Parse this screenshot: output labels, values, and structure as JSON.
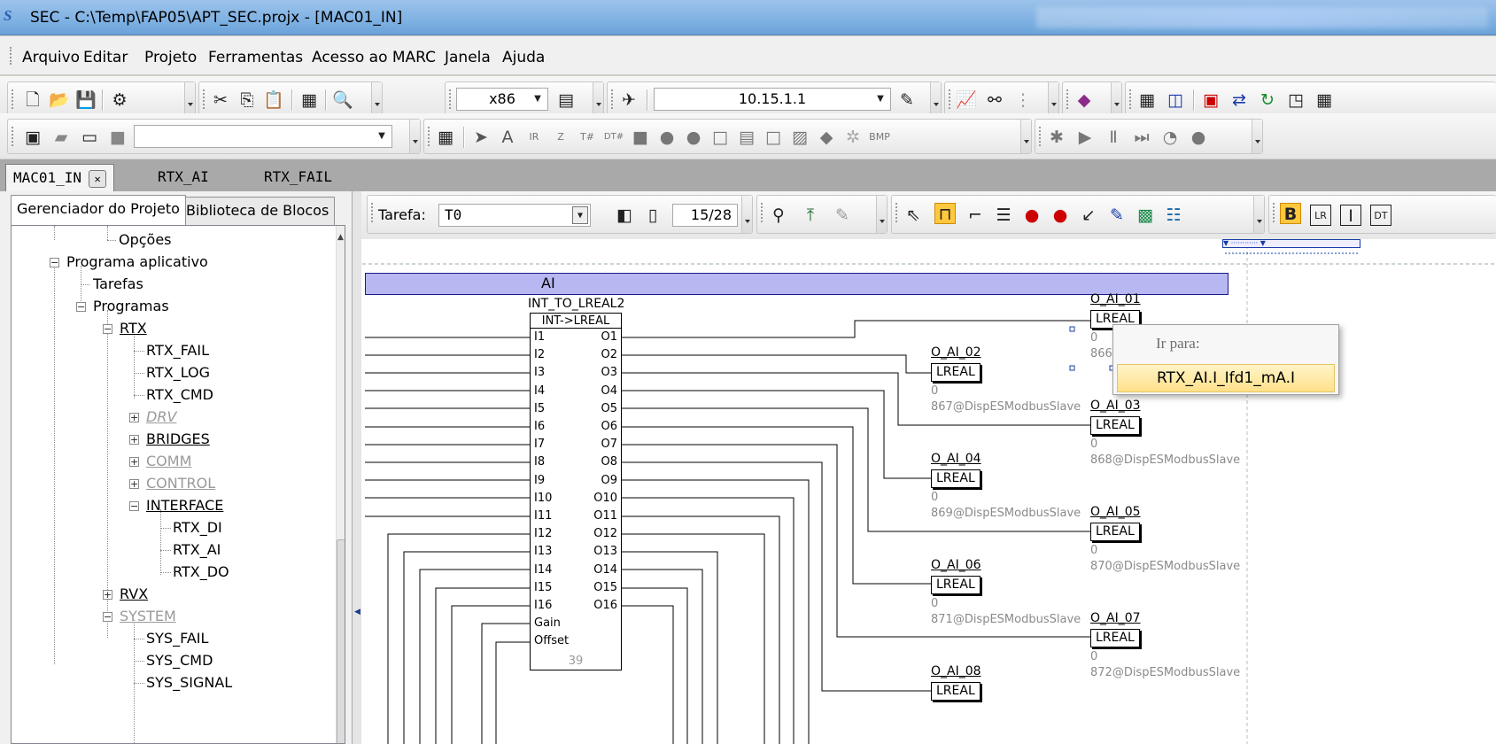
{
  "window": {
    "title": "SEC - C:\\Temp\\FAP05\\APT_SEC.projx - [MAC01_IN]",
    "logo": "S"
  },
  "menu": [
    "Arquivo",
    "Editar",
    "Projeto",
    "Ferramentas",
    "Acesso ao MARC",
    "Janela",
    "Ajuda"
  ],
  "toolbar": {
    "platform": "x86",
    "ip": "10.15.1.1"
  },
  "doc_tabs": [
    "MAC01_IN",
    "RTX_AI",
    "RTX_FAIL"
  ],
  "panel_tabs": [
    "Gerenciador do Projeto",
    "Biblioteca de Blocos"
  ],
  "tree": [
    {
      "label": "Opções"
    },
    {
      "label": "Programa aplicativo"
    },
    {
      "label": "Tarefas"
    },
    {
      "label": "Programas"
    },
    {
      "label": "RTX"
    },
    {
      "label": "RTX_FAIL"
    },
    {
      "label": "RTX_LOG"
    },
    {
      "label": "RTX_CMD"
    },
    {
      "label": "DRV"
    },
    {
      "label": "BRIDGES"
    },
    {
      "label": "COMM"
    },
    {
      "label": "CONTROL"
    },
    {
      "label": "INTERFACE"
    },
    {
      "label": "RTX_DI"
    },
    {
      "label": "RTX_AI"
    },
    {
      "label": "RTX_DO"
    },
    {
      "label": "RVX"
    },
    {
      "label": "SYSTEM"
    },
    {
      "label": "SYS_FAIL"
    },
    {
      "label": "SYS_CMD"
    },
    {
      "label": "SYS_SIGNAL"
    }
  ],
  "diagram": {
    "task_label": "Tarefa:",
    "task_value": "T0",
    "page": "15/28",
    "section": "AI",
    "block": {
      "name": "INT_TO_LREAL2",
      "type": "INT->LREAL",
      "inputs": [
        "I1",
        "I2",
        "I3",
        "I4",
        "I5",
        "I6",
        "I7",
        "I8",
        "I9",
        "I10",
        "I11",
        "I12",
        "I13",
        "I14",
        "I15",
        "I16",
        "Gain",
        "Offset"
      ],
      "outputs": [
        "O1",
        "O2",
        "O3",
        "O4",
        "O5",
        "O6",
        "O7",
        "O8",
        "O9",
        "O10",
        "O11",
        "O12",
        "O13",
        "O14",
        "O15",
        "O16"
      ],
      "id": "39"
    },
    "type_label": "LREAL",
    "value": "0",
    "vars": [
      {
        "name": "O_AI_01",
        "addr": "866@"
      },
      {
        "name": "O_AI_02",
        "addr": "867@DispESModbusSlave"
      },
      {
        "name": "O_AI_03",
        "addr": "868@DispESModbusSlave"
      },
      {
        "name": "O_AI_04",
        "addr": "869@DispESModbusSlave"
      },
      {
        "name": "O_AI_05",
        "addr": "870@DispESModbusSlave"
      },
      {
        "name": "O_AI_06",
        "addr": "871@DispESModbusSlave"
      },
      {
        "name": "O_AI_07",
        "addr": "872@DispESModbusSlave"
      },
      {
        "name": "O_AI_08",
        "addr": ""
      }
    ]
  },
  "popup": {
    "header": "Ir para:",
    "item": "RTX_AI.I_Ifd1_mA.I"
  }
}
